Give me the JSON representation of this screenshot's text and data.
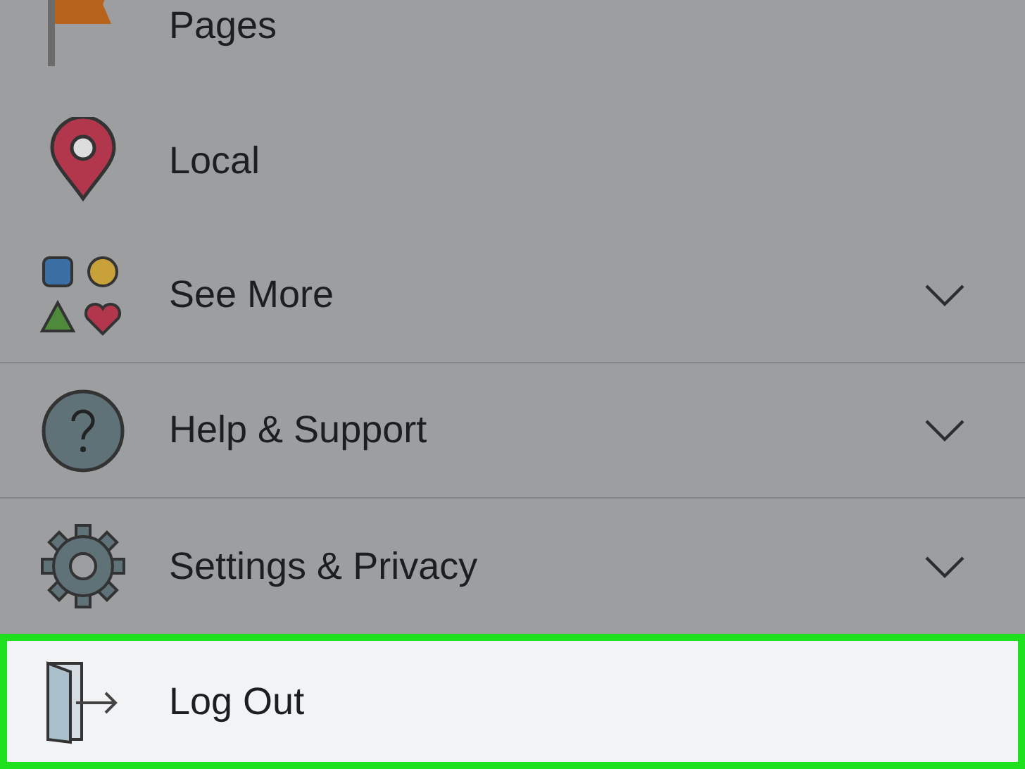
{
  "menu_items": [
    {
      "label": "Pages",
      "kind": "link",
      "selected": false
    },
    {
      "label": "Local",
      "kind": "link",
      "selected": false
    },
    {
      "label": "See More",
      "kind": "expandable",
      "selected": false
    },
    {
      "label": "Help & Support",
      "kind": "expandable",
      "selected": false
    },
    {
      "label": "Settings & Privacy",
      "kind": "expandable",
      "selected": false
    },
    {
      "label": "Log Out",
      "kind": "link",
      "selected": true
    }
  ]
}
